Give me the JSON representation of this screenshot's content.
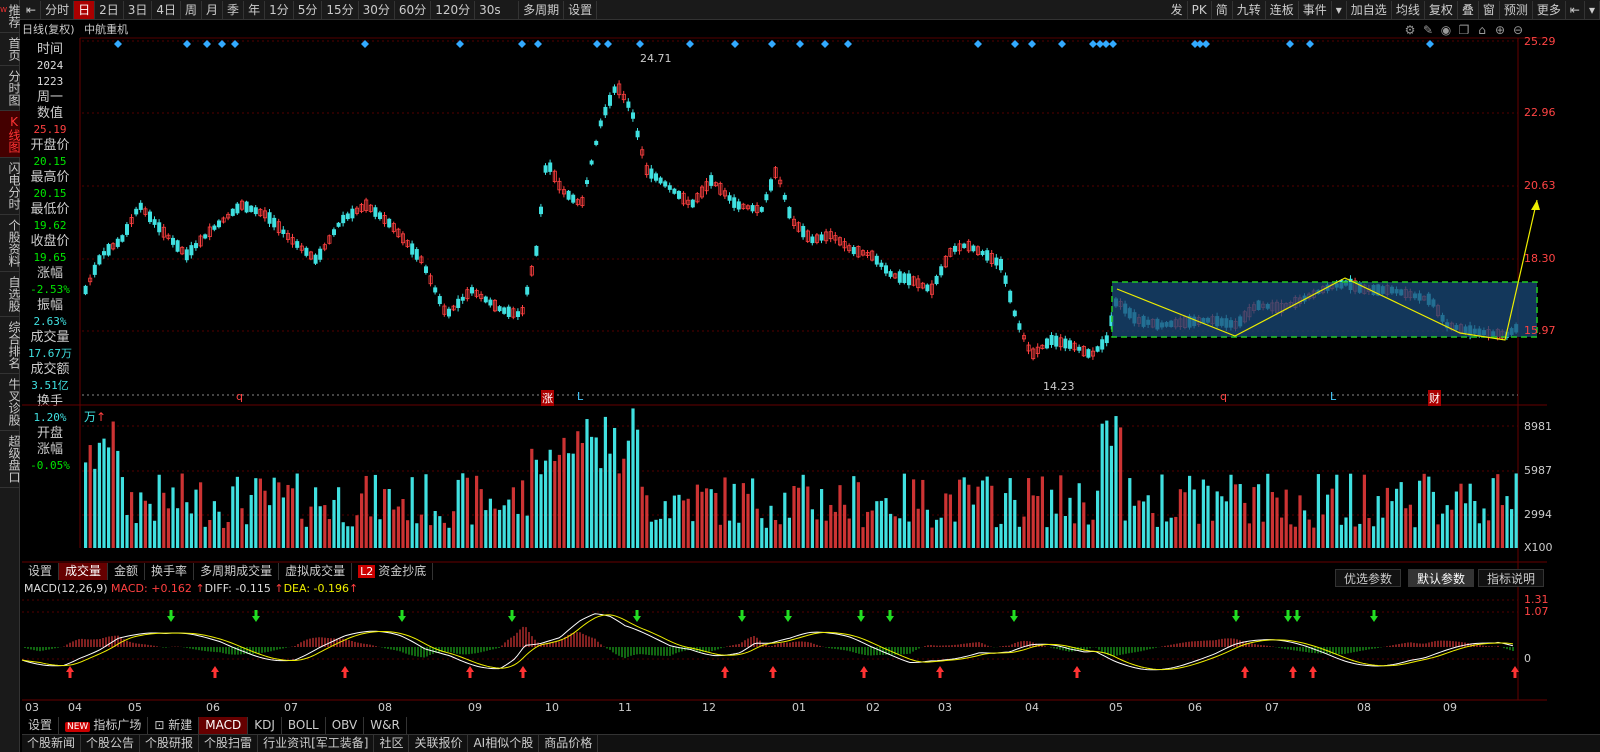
{
  "topbar": {
    "items": [
      "分时",
      "日",
      "2日",
      "3日",
      "4日",
      "周",
      "月",
      "季",
      "年",
      "1分",
      "5分",
      "15分",
      "30分",
      "60分",
      "120分",
      "30s",
      "多周期",
      "设置"
    ],
    "active": "日",
    "right_items": [
      "发",
      "PK",
      "简",
      "九转",
      "连板",
      "事件",
      "加自选",
      "均线",
      "复权",
      "叠",
      "窗",
      "预测",
      "更多"
    ]
  },
  "leftnav": {
    "items": [
      "推荐",
      "首页",
      "分时图",
      "K线图",
      "闪电分时",
      "个股资料",
      "自选股",
      "综合排名",
      "牛叉诊股",
      "超级盘口"
    ],
    "active": "K线图",
    "new_badge": "NEW"
  },
  "info": {
    "mode": "日线(复权)",
    "name": "中航重机"
  },
  "side": {
    "time_label": "时间",
    "date_year": "2024",
    "date_md": "1223",
    "weekday": "周一",
    "value_label": "数值",
    "value": "25.19",
    "open_label": "开盘价",
    "open": "20.15",
    "high_label": "最高价",
    "high": "20.15",
    "low_label": "最低价",
    "low": "19.62",
    "close_label": "收盘价",
    "close": "19.65",
    "change_label": "涨幅",
    "change": "-2.53%",
    "amp_label": "振幅",
    "amp": "2.63%",
    "vol_label": "成交量",
    "vol": "17.67万",
    "amt_label": "成交额",
    "amt": "3.51亿",
    "turn_label": "换手",
    "turn": "1.20%",
    "open_chg_label1": "开盘",
    "open_chg_label2": "涨幅",
    "open_chg": "-0.05%"
  },
  "price_axis": [
    "25.29",
    "22.96",
    "20.63",
    "18.30",
    "15.97"
  ],
  "price_marks": {
    "high": "24.71",
    "low": "14.23"
  },
  "volume_axis": [
    "8981",
    "5987",
    "2994",
    "X100"
  ],
  "volume_unit": "万",
  "volume_tabs": [
    "设置",
    "成交量",
    "金额",
    "换手率",
    "多周期成交量",
    "虚拟成交量",
    "资金抄底"
  ],
  "volume_tabs_active": "成交量",
  "l2_label": "L2",
  "macd": {
    "title": "MACD(12,26,9)",
    "macd_label": "MACD: +0.162",
    "diff_label": "DIFF: -0.115",
    "dea_label": "DEA: -0.196",
    "axis": [
      "1.31",
      "1.07",
      "0"
    ],
    "buttons": [
      "优选参数",
      "默认参数",
      "指标说明"
    ]
  },
  "months": [
    "03",
    "04",
    "05",
    "06",
    "07",
    "08",
    "09",
    "10",
    "11",
    "12",
    "01",
    "02",
    "03",
    "04",
    "05",
    "06",
    "07",
    "08",
    "09"
  ],
  "event_marks": [
    "q",
    "涨",
    "L",
    "q",
    "L",
    "财"
  ],
  "indicator_tabs": [
    "设置",
    "指标广场",
    "新建",
    "MACD",
    "KDJ",
    "BOLL",
    "OBV",
    "W&R"
  ],
  "indicator_new": "NEW",
  "indicator_active": "MACD",
  "bottom_tabs": [
    "个股新闻",
    "个股公告",
    "个股研报",
    "个股扫雷",
    "行业资讯[军工装备]",
    "社区",
    "关联报价",
    "AI相似个股",
    "商品价格"
  ],
  "colors": {
    "up": "#ff4040",
    "down": "#40e0e0",
    "bg": "#000000",
    "accent": "#cc0000"
  }
}
